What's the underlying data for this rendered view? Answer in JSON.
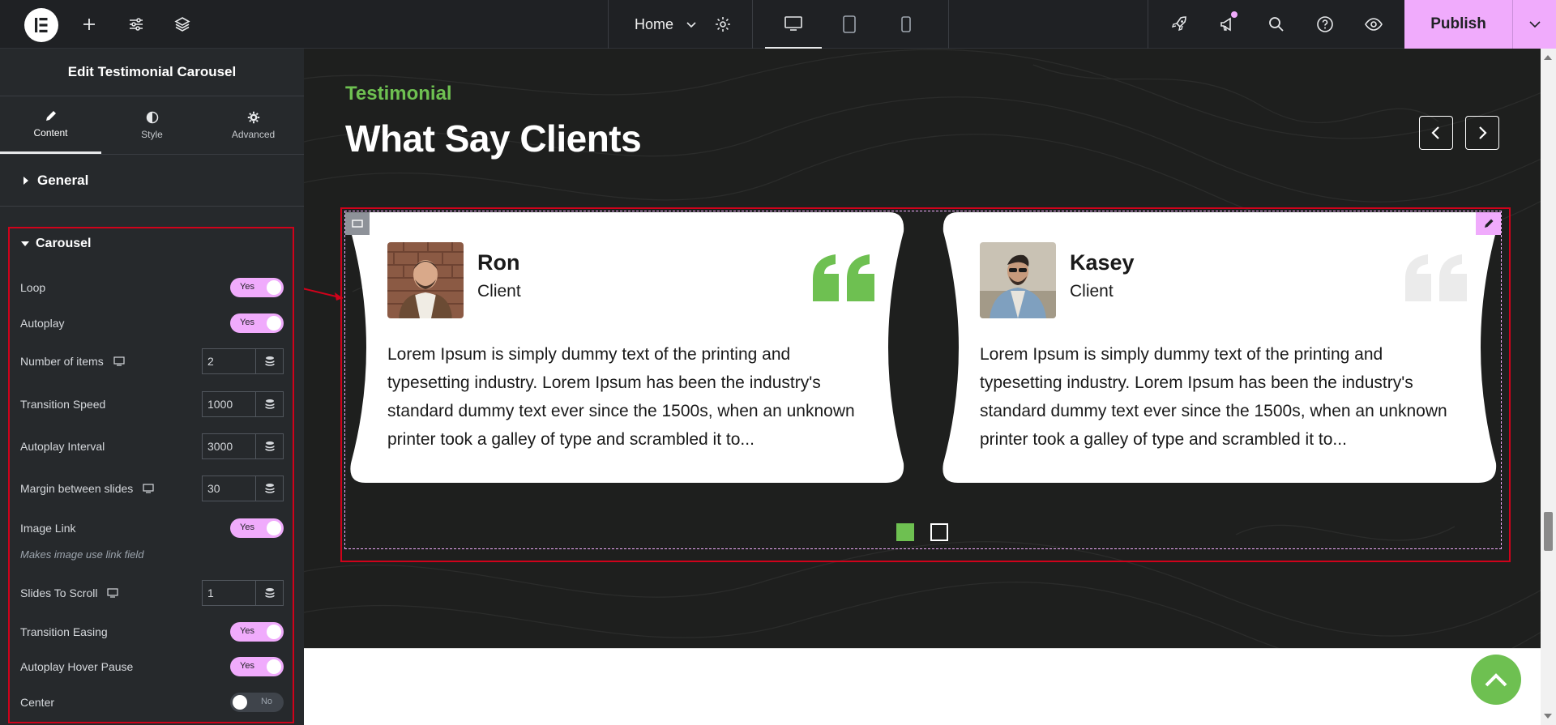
{
  "topbar": {
    "page_name": "Home",
    "publish_label": "Publish"
  },
  "panel": {
    "title": "Edit Testimonial Carousel",
    "tabs": [
      {
        "label": "Content",
        "icon": "pencil-icon"
      },
      {
        "label": "Style",
        "icon": "half-circle-icon"
      },
      {
        "label": "Advanced",
        "icon": "gear-icon"
      }
    ],
    "sections": {
      "general": "General",
      "carousel": "Carousel"
    },
    "controls": {
      "loop": {
        "label": "Loop",
        "value": "Yes"
      },
      "autoplay": {
        "label": "Autoplay",
        "value": "Yes"
      },
      "number_of_items": {
        "label": "Number of items",
        "value": "2"
      },
      "transition_speed": {
        "label": "Transition Speed",
        "value": "1000"
      },
      "autoplay_interval": {
        "label": "Autoplay Interval",
        "value": "3000"
      },
      "margin_between_slides": {
        "label": "Margin between slides",
        "value": "30"
      },
      "image_link": {
        "label": "Image Link",
        "value": "Yes",
        "hint": "Makes image use link field"
      },
      "slides_to_scroll": {
        "label": "Slides To Scroll",
        "value": "1"
      },
      "transition_easing": {
        "label": "Transition Easing",
        "value": "Yes"
      },
      "autoplay_hover_pause": {
        "label": "Autoplay Hover Pause",
        "value": "Yes"
      },
      "center": {
        "label": "Center",
        "value": "No"
      }
    }
  },
  "canvas": {
    "eyebrow": "Testimonial",
    "heading": "What Say Clients",
    "testimonials": [
      {
        "name": "Ron",
        "role": "Client",
        "text": "Lorem Ipsum is simply dummy text of the printing and typesetting industry. Lorem Ipsum has been the industry's standard dummy text ever since the 1500s, when an unknown printer took a galley of type and scrambled it to..."
      },
      {
        "name": "Kasey",
        "role": "Client",
        "text": "Lorem Ipsum is simply dummy text of the printing and typesetting industry. Lorem Ipsum has been the industry's standard dummy text ever since the 1500s, when an unknown printer took a galley of type and scrambled it to..."
      }
    ],
    "pagination": {
      "active_index": 1,
      "count": 2
    }
  },
  "colors": {
    "accent": "#f0abfc",
    "brand_green": "#6ec051",
    "selection_red": "#d0021b",
    "panel_bg": "#26292c",
    "canvas_bg": "#1e1f1e"
  }
}
